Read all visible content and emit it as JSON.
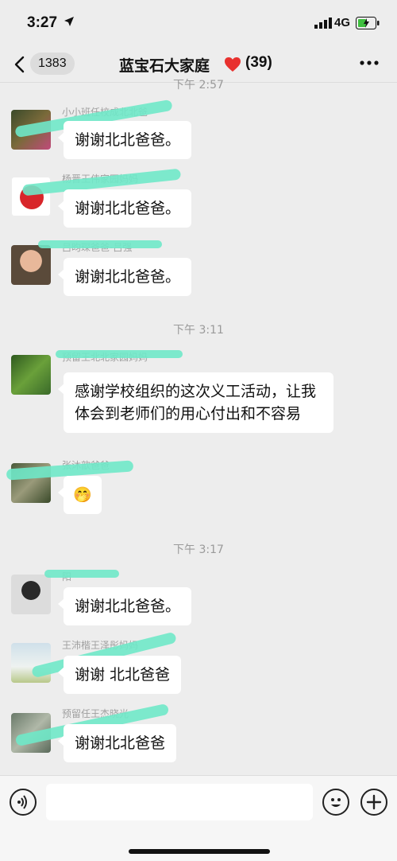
{
  "status": {
    "time": "3:27",
    "network": "4G"
  },
  "nav": {
    "back_count": "1383",
    "title": "蓝宝石大家庭",
    "member_count": "(39)"
  },
  "timestamps": {
    "t1": "下午 2:57",
    "t2": "下午 3:11",
    "t3": "下午 3:17"
  },
  "messages": [
    {
      "sender": "小小班任校成北北爸",
      "text": "谢谢北北爸爸。"
    },
    {
      "sender": "杨晋王伟家园妈妈",
      "text": "谢谢北北爸爸。"
    },
    {
      "sender": "吕昀琛爸爸-吕强",
      "text": "谢谢北北爸爸。"
    },
    {
      "sender": "预留王北北家园妈妈",
      "text": "感谢学校组织的这次义工活动，让我体会到老师们的用心付出和不容易"
    },
    {
      "sender": "张沐歆爸爸",
      "text": "🤭"
    },
    {
      "sender": "阳",
      "text": "谢谢北北爸爸。"
    },
    {
      "sender": "王沛楷王泽彤妈妈",
      "text": "谢谢 北北爸爸"
    },
    {
      "sender": "预留任王杰晓光",
      "text": "谢谢北北爸爸"
    }
  ],
  "colors": {
    "background": "#EDEDED",
    "bubble": "#FFFFFF",
    "scribble": "#6FE8C8",
    "heart": "#E8312E"
  },
  "icons": [
    "location-arrow-icon",
    "signal-icon",
    "battery-icon",
    "back-chevron-icon",
    "heart-icon",
    "more-icon",
    "voice-icon",
    "emoji-icon",
    "plus-icon"
  ]
}
